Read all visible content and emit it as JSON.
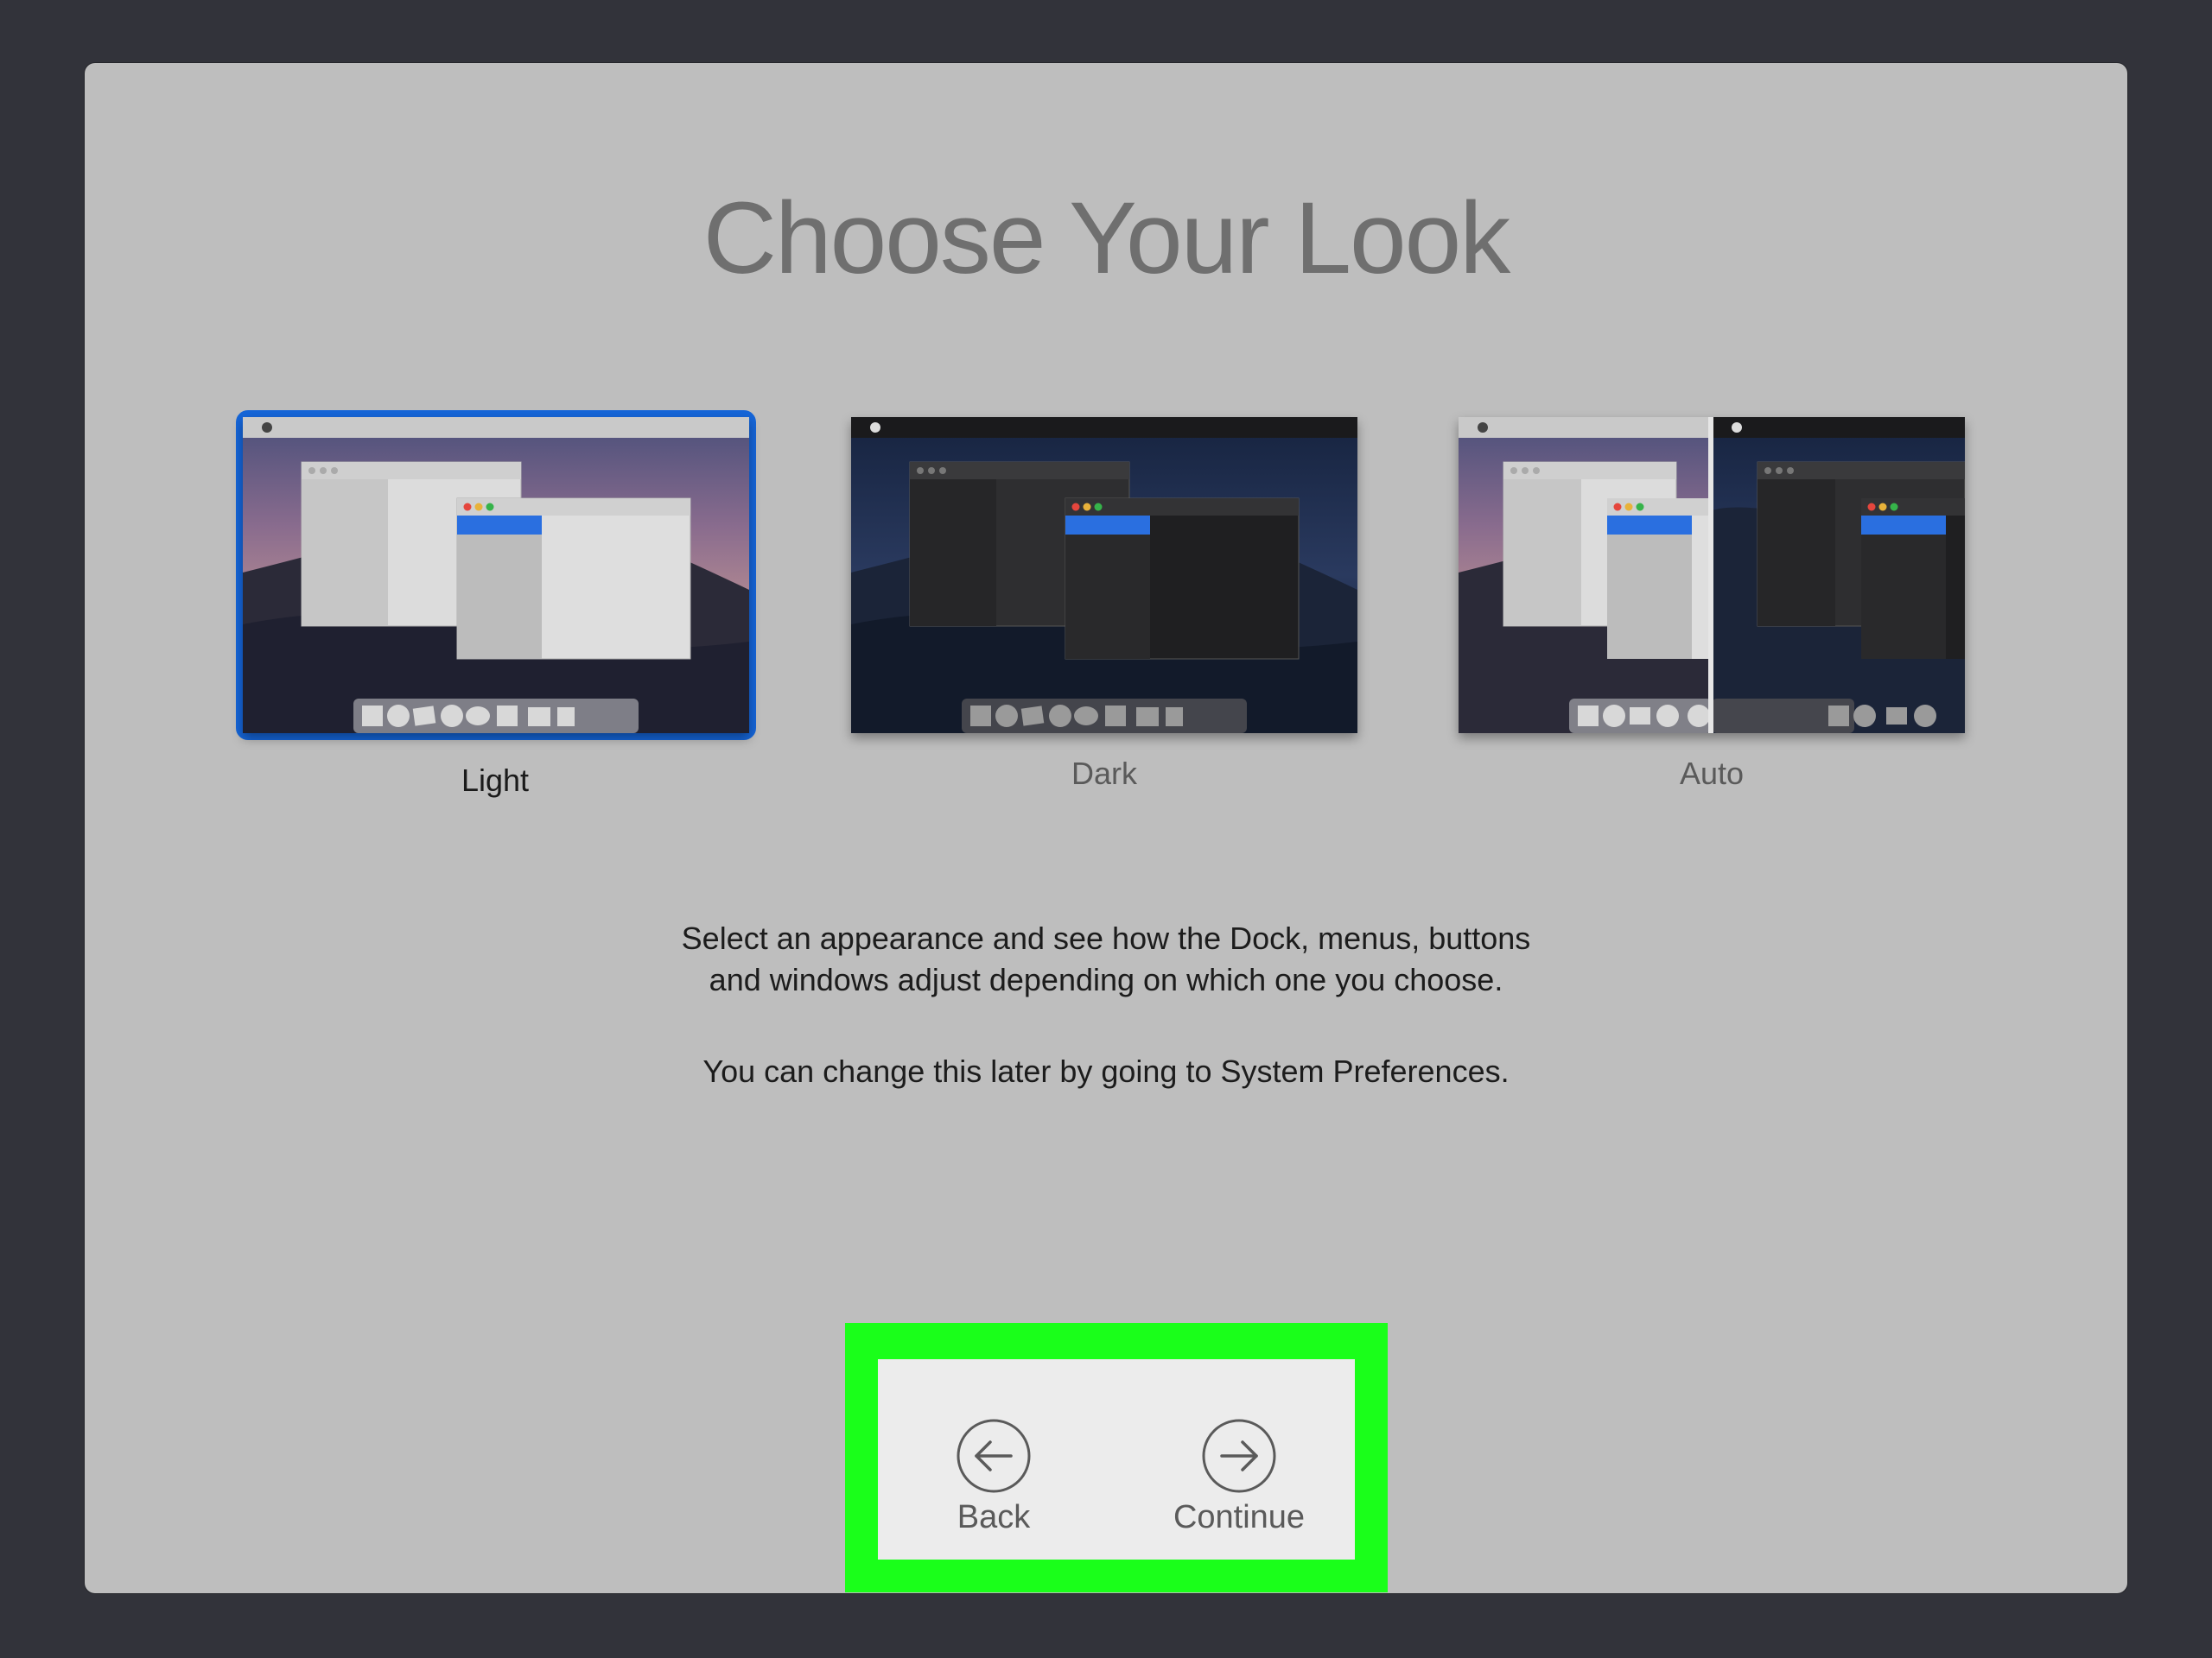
{
  "page": {
    "title": "Choose Your Look"
  },
  "options": [
    {
      "label": "Light",
      "selected": true
    },
    {
      "label": "Dark",
      "selected": false
    },
    {
      "label": "Auto",
      "selected": false
    }
  ],
  "description": {
    "line1": "Select an appearance and see how the Dock, menus, buttons",
    "line2": "and windows adjust depending on which one you choose.",
    "line3": "You can change this later by going to System Preferences."
  },
  "nav": {
    "back_label": "Back",
    "continue_label": "Continue",
    "back_icon": "arrow-left-circle-icon",
    "continue_icon": "arrow-right-circle-icon"
  },
  "colors": {
    "selection_border": "#1565d8",
    "highlight_box": "#1aff1a",
    "panel_bg": "#bebebe",
    "screen_bg": "#32333a"
  }
}
